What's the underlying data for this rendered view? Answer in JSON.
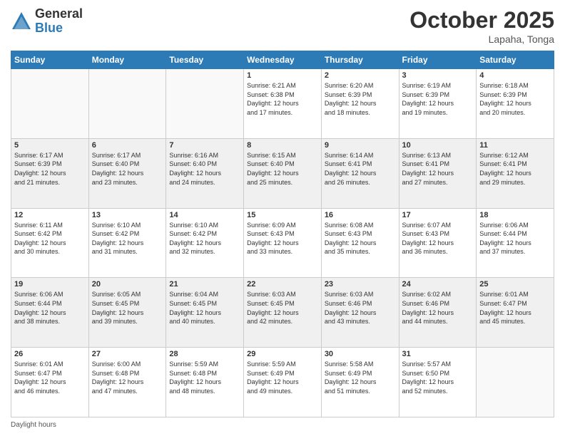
{
  "logo": {
    "general": "General",
    "blue": "Blue"
  },
  "header": {
    "month": "October 2025",
    "location": "Lapaha, Tonga"
  },
  "weekdays": [
    "Sunday",
    "Monday",
    "Tuesday",
    "Wednesday",
    "Thursday",
    "Friday",
    "Saturday"
  ],
  "weeks": [
    {
      "shaded": false,
      "days": [
        {
          "num": "",
          "info": ""
        },
        {
          "num": "",
          "info": ""
        },
        {
          "num": "",
          "info": ""
        },
        {
          "num": "1",
          "info": "Sunrise: 6:21 AM\nSunset: 6:38 PM\nDaylight: 12 hours\nand 17 minutes."
        },
        {
          "num": "2",
          "info": "Sunrise: 6:20 AM\nSunset: 6:39 PM\nDaylight: 12 hours\nand 18 minutes."
        },
        {
          "num": "3",
          "info": "Sunrise: 6:19 AM\nSunset: 6:39 PM\nDaylight: 12 hours\nand 19 minutes."
        },
        {
          "num": "4",
          "info": "Sunrise: 6:18 AM\nSunset: 6:39 PM\nDaylight: 12 hours\nand 20 minutes."
        }
      ]
    },
    {
      "shaded": true,
      "days": [
        {
          "num": "5",
          "info": "Sunrise: 6:17 AM\nSunset: 6:39 PM\nDaylight: 12 hours\nand 21 minutes."
        },
        {
          "num": "6",
          "info": "Sunrise: 6:17 AM\nSunset: 6:40 PM\nDaylight: 12 hours\nand 23 minutes."
        },
        {
          "num": "7",
          "info": "Sunrise: 6:16 AM\nSunset: 6:40 PM\nDaylight: 12 hours\nand 24 minutes."
        },
        {
          "num": "8",
          "info": "Sunrise: 6:15 AM\nSunset: 6:40 PM\nDaylight: 12 hours\nand 25 minutes."
        },
        {
          "num": "9",
          "info": "Sunrise: 6:14 AM\nSunset: 6:41 PM\nDaylight: 12 hours\nand 26 minutes."
        },
        {
          "num": "10",
          "info": "Sunrise: 6:13 AM\nSunset: 6:41 PM\nDaylight: 12 hours\nand 27 minutes."
        },
        {
          "num": "11",
          "info": "Sunrise: 6:12 AM\nSunset: 6:41 PM\nDaylight: 12 hours\nand 29 minutes."
        }
      ]
    },
    {
      "shaded": false,
      "days": [
        {
          "num": "12",
          "info": "Sunrise: 6:11 AM\nSunset: 6:42 PM\nDaylight: 12 hours\nand 30 minutes."
        },
        {
          "num": "13",
          "info": "Sunrise: 6:10 AM\nSunset: 6:42 PM\nDaylight: 12 hours\nand 31 minutes."
        },
        {
          "num": "14",
          "info": "Sunrise: 6:10 AM\nSunset: 6:42 PM\nDaylight: 12 hours\nand 32 minutes."
        },
        {
          "num": "15",
          "info": "Sunrise: 6:09 AM\nSunset: 6:43 PM\nDaylight: 12 hours\nand 33 minutes."
        },
        {
          "num": "16",
          "info": "Sunrise: 6:08 AM\nSunset: 6:43 PM\nDaylight: 12 hours\nand 35 minutes."
        },
        {
          "num": "17",
          "info": "Sunrise: 6:07 AM\nSunset: 6:43 PM\nDaylight: 12 hours\nand 36 minutes."
        },
        {
          "num": "18",
          "info": "Sunrise: 6:06 AM\nSunset: 6:44 PM\nDaylight: 12 hours\nand 37 minutes."
        }
      ]
    },
    {
      "shaded": true,
      "days": [
        {
          "num": "19",
          "info": "Sunrise: 6:06 AM\nSunset: 6:44 PM\nDaylight: 12 hours\nand 38 minutes."
        },
        {
          "num": "20",
          "info": "Sunrise: 6:05 AM\nSunset: 6:45 PM\nDaylight: 12 hours\nand 39 minutes."
        },
        {
          "num": "21",
          "info": "Sunrise: 6:04 AM\nSunset: 6:45 PM\nDaylight: 12 hours\nand 40 minutes."
        },
        {
          "num": "22",
          "info": "Sunrise: 6:03 AM\nSunset: 6:45 PM\nDaylight: 12 hours\nand 42 minutes."
        },
        {
          "num": "23",
          "info": "Sunrise: 6:03 AM\nSunset: 6:46 PM\nDaylight: 12 hours\nand 43 minutes."
        },
        {
          "num": "24",
          "info": "Sunrise: 6:02 AM\nSunset: 6:46 PM\nDaylight: 12 hours\nand 44 minutes."
        },
        {
          "num": "25",
          "info": "Sunrise: 6:01 AM\nSunset: 6:47 PM\nDaylight: 12 hours\nand 45 minutes."
        }
      ]
    },
    {
      "shaded": false,
      "days": [
        {
          "num": "26",
          "info": "Sunrise: 6:01 AM\nSunset: 6:47 PM\nDaylight: 12 hours\nand 46 minutes."
        },
        {
          "num": "27",
          "info": "Sunrise: 6:00 AM\nSunset: 6:48 PM\nDaylight: 12 hours\nand 47 minutes."
        },
        {
          "num": "28",
          "info": "Sunrise: 5:59 AM\nSunset: 6:48 PM\nDaylight: 12 hours\nand 48 minutes."
        },
        {
          "num": "29",
          "info": "Sunrise: 5:59 AM\nSunset: 6:49 PM\nDaylight: 12 hours\nand 49 minutes."
        },
        {
          "num": "30",
          "info": "Sunrise: 5:58 AM\nSunset: 6:49 PM\nDaylight: 12 hours\nand 51 minutes."
        },
        {
          "num": "31",
          "info": "Sunrise: 5:57 AM\nSunset: 6:50 PM\nDaylight: 12 hours\nand 52 minutes."
        },
        {
          "num": "",
          "info": ""
        }
      ]
    }
  ],
  "footer": {
    "daylight_label": "Daylight hours"
  }
}
